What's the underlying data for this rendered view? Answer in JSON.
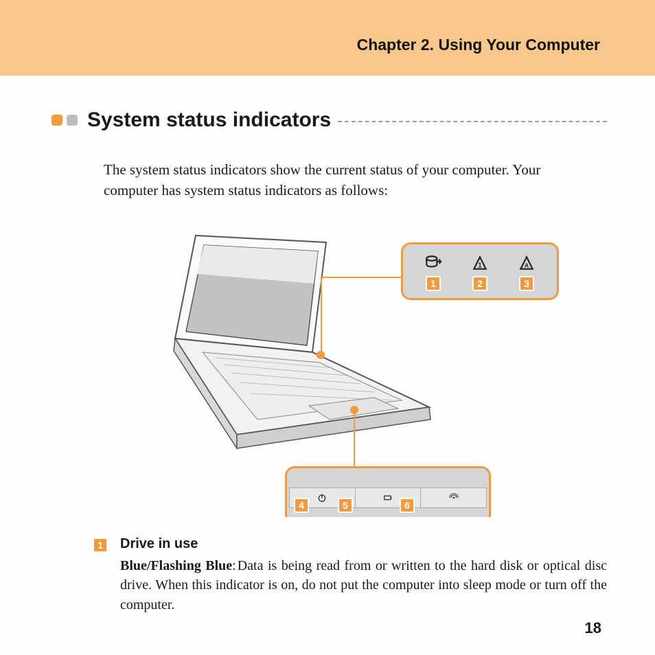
{
  "header": {
    "chapter": "Chapter 2. Using Your Computer"
  },
  "section": {
    "title": "System status indicators",
    "intro": "The system status indicators show the current status of your computer. Your computer has system status indicators as follows:"
  },
  "callouts": {
    "top": [
      {
        "num": "1",
        "icon": "hdd-icon"
      },
      {
        "num": "2",
        "icon": "numlock-icon"
      },
      {
        "num": "3",
        "icon": "capslock-icon"
      }
    ],
    "bottom": [
      {
        "num": "4",
        "icon": "power-icon"
      },
      {
        "num": "5",
        "icon": "battery-icon"
      },
      {
        "num": "6",
        "icon": "wireless-icon"
      }
    ]
  },
  "entries": [
    {
      "num": "1",
      "title": "Drive in use",
      "status": "Blue/Flashing Blue",
      "desc": "Data is being read from or written to the hard disk or optical disc drive. When this indicator is on, do not put the computer into sleep mode or turn off the computer."
    }
  ],
  "page": "18"
}
